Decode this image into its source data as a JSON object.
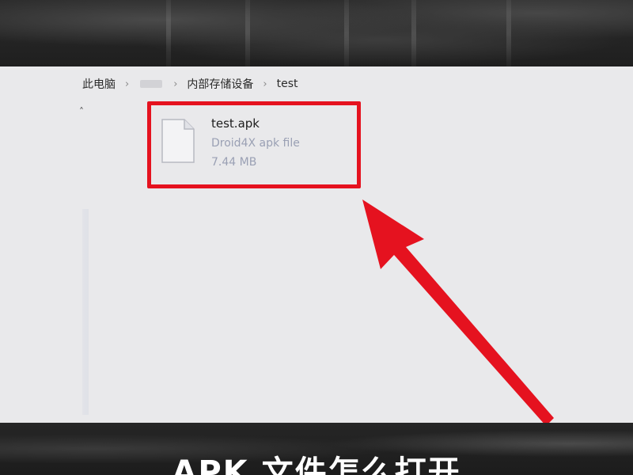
{
  "breadcrumb": {
    "items": [
      "此电脑",
      "内部存储设备",
      "test"
    ],
    "separator": "›"
  },
  "collapse_caret": "˄",
  "file": {
    "name": "test.apk",
    "type": "Droid4X apk file",
    "size": "7.44 MB",
    "icon": "document-icon"
  },
  "caption": "APK 文件怎么打开",
  "colors": {
    "highlight": "#e5121f",
    "arrow": "#e5121f",
    "window_bg": "#e9e9eb",
    "band_bg": "#232323"
  }
}
